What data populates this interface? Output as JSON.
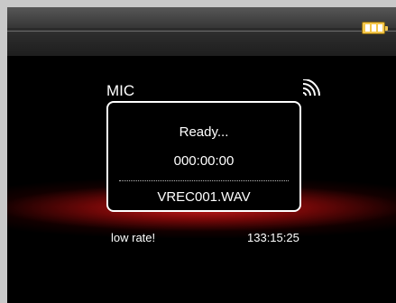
{
  "screen": {
    "source_label": "MIC",
    "record": {
      "status": "Ready...",
      "elapsed_time": "000:00:00",
      "file_name": "VREC001.WAV"
    },
    "rate_warning": "low rate!",
    "remaining_time": "133:15:25"
  },
  "icons": {
    "battery": "battery-full-icon",
    "signal": "signal-waves-icon"
  },
  "colors": {
    "battery": "#f3c64a",
    "glow": "#d21e1e",
    "text": "#ffffff"
  }
}
